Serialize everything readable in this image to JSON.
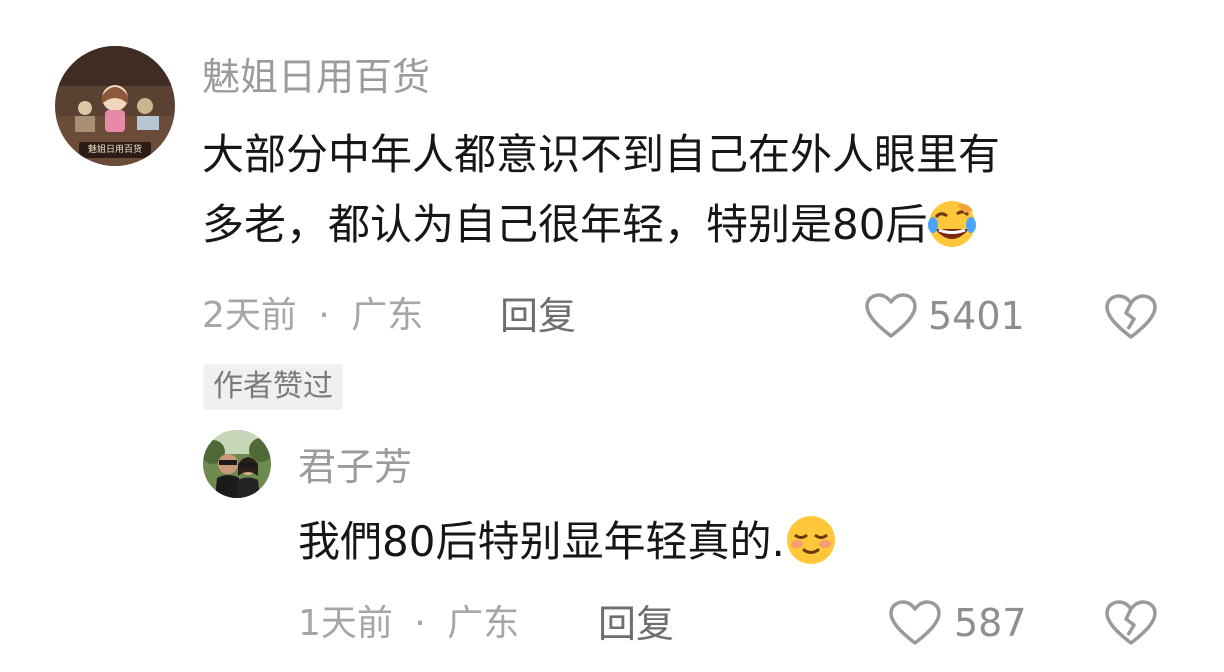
{
  "comments": [
    {
      "username": "魅姐日用百货",
      "avatar_sign": "魅姐日用百货",
      "text_line1": "大部分中年人都意识不到自己在外人眼里有",
      "text_line2": "多老，都认为自己很年轻，特别是80后",
      "emoji": "rolling-laughing",
      "time": "2天前",
      "separator": "·",
      "location": "广东",
      "reply_label": "回复",
      "like_count": "5401",
      "badge": "作者赞过"
    },
    {
      "username": "君子芳",
      "text": "我們80后特别显年轻真的.",
      "emoji": "content-smile",
      "time": "1天前",
      "separator": "·",
      "location": "广东",
      "reply_label": "回复",
      "like_count": "587"
    }
  ],
  "colors": {
    "username": "#9b9b9b",
    "text": "#161616",
    "meta": "#a6a6a6",
    "reply": "#6e6e6e",
    "icon": "#9a9a9a",
    "badge_bg": "#f0f0f0",
    "emoji_yellow": "#ffc83a"
  },
  "icons": [
    "heart-outline-icon",
    "broken-heart-icon"
  ]
}
